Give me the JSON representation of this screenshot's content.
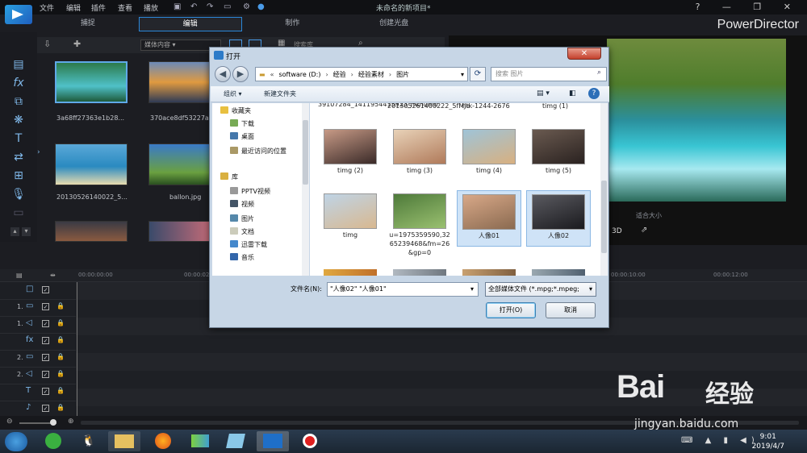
{
  "menu": {
    "file": "文件",
    "edit": "编辑",
    "plugin": "插件",
    "view": "查看",
    "play": "播放"
  },
  "project_title": "未命名的新项目*",
  "brand": "PowerDirector",
  "window_controls": "? — ❐ ✕",
  "mode_tabs": [
    {
      "label": "捕捉"
    },
    {
      "label": "编辑"
    },
    {
      "label": "制作"
    },
    {
      "label": "创建光盘"
    }
  ],
  "library": {
    "filter": "媒体内容",
    "search_placeholder": "搜索库",
    "items": [
      {
        "label": "3a68ff27363e1b28..."
      },
      {
        "label": "370ace8df53227a..."
      },
      {
        "label": "20130526140022_5..."
      },
      {
        "label": "ballon.jpg"
      },
      {
        "label": ""
      },
      {
        "label": ""
      }
    ]
  },
  "preview": {
    "fit_label": "适合大小",
    "mode": "3D"
  },
  "timeline": {
    "ruler": [
      "00:00:00:00",
      "00:00:02",
      "00:00:10:00",
      "00:00:12:00"
    ],
    "tracks": [
      {
        "num": "",
        "sym": "□"
      },
      {
        "num": "1.",
        "sym": "▭"
      },
      {
        "num": "1.",
        "sym": "◁"
      },
      {
        "num": "",
        "sym": "fx"
      },
      {
        "num": "2.",
        "sym": "▭"
      },
      {
        "num": "2.",
        "sym": "◁"
      },
      {
        "num": "",
        "sym": "T"
      },
      {
        "num": "",
        "sym": "♪"
      }
    ]
  },
  "dialog": {
    "title": "打开",
    "path": [
      "software (D:)",
      "经验",
      "经验素材",
      "图片"
    ],
    "search_placeholder": "搜索 图片",
    "organize": "组织 ▾",
    "new_folder": "新建文件夹",
    "nav": [
      {
        "label": "收藏夹",
        "color": "#e8c040"
      },
      {
        "label": "下载",
        "color": "#7a5"
      },
      {
        "label": "桌面",
        "color": "#47a"
      },
      {
        "label": "最近访问的位置",
        "color": "#a96"
      },
      {
        "label": "库",
        "color": "#d9b040"
      },
      {
        "label": "PPTV视频",
        "color": "#999"
      },
      {
        "label": "视频",
        "color": "#456"
      },
      {
        "label": "图片",
        "color": "#58a"
      },
      {
        "label": "文档",
        "color": "#ccb"
      },
      {
        "label": "迅雷下载",
        "color": "#48c"
      },
      {
        "label": "音乐",
        "color": "#36a"
      }
    ],
    "top_names": [
      "39107284_1411954415923_mthumb",
      "201305261400222_5fMJe",
      "ntk-1244-2676",
      "timg (1)"
    ],
    "files": [
      {
        "name": "timg (2)",
        "selected": false,
        "c1": "#c79a86",
        "c2": "#3a2a28"
      },
      {
        "name": "timg (3)",
        "selected": false,
        "c1": "#e8d2b8",
        "c2": "#b07a5a"
      },
      {
        "name": "timg (4)",
        "selected": false,
        "c1": "#9fc4d8",
        "c2": "#d8b080"
      },
      {
        "name": "timg (5)",
        "selected": false,
        "c1": "#6a5a50",
        "c2": "#2a2220"
      },
      {
        "name": "timg",
        "selected": false,
        "c1": "#bfd4e6",
        "c2": "#d8b890"
      },
      {
        "name": "u=1975359590,3265239468&fm=26&gp=0",
        "selected": false,
        "c1": "#4e7a3a",
        "c2": "#9ac070"
      },
      {
        "name": "人像01",
        "selected": true,
        "c1": "#d8a888",
        "c2": "#8a6a50"
      },
      {
        "name": "人像02",
        "selected": true,
        "c1": "#5a5a60",
        "c2": "#1a1a1e"
      }
    ],
    "filename_label": "文件名(N):",
    "filename_value": "\"人像02\" \"人像01\"",
    "filetype": "全部媒体文件 (*.mpg;*.mpeg;",
    "open": "打开(O)",
    "cancel": "取消"
  },
  "taskbar": {
    "time": "9:01",
    "date": "2019/4/7"
  },
  "watermark": {
    "logo": "Bai",
    "text": "经验",
    "url": "jingyan.baidu.com"
  }
}
